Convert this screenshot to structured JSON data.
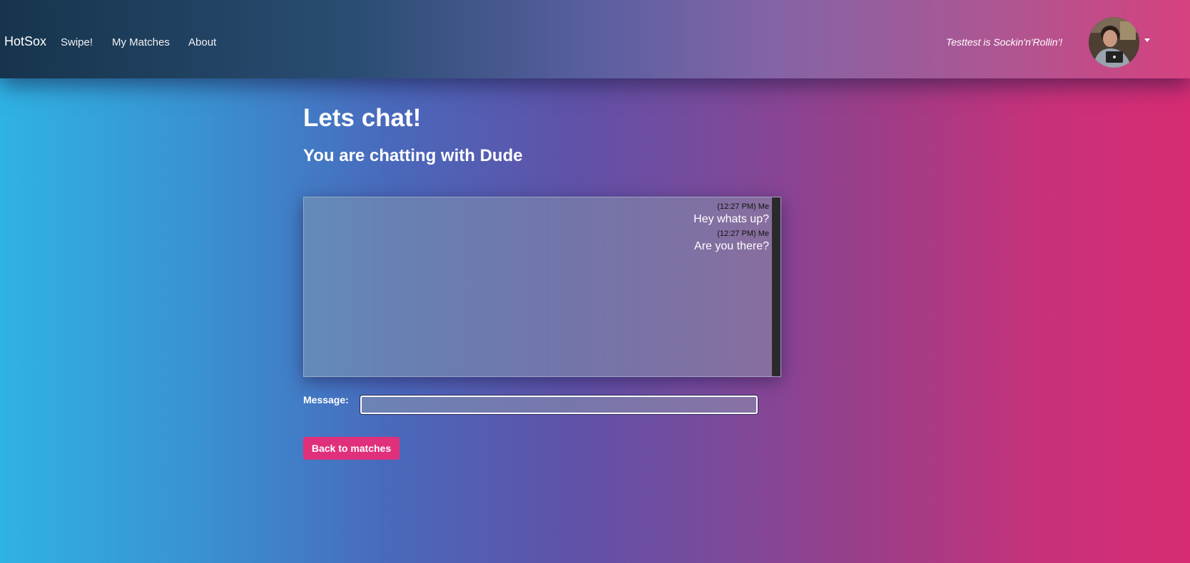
{
  "nav": {
    "brand": "HotSox",
    "links": [
      "Swipe!",
      "My Matches",
      "About"
    ],
    "greeting": "Testtest is Sockin'n'Rollin'!"
  },
  "page": {
    "title": "Lets chat!",
    "subtitle": "You are chatting with Dude"
  },
  "chat": {
    "messages": [
      {
        "meta": "(12:27 PM) Me",
        "text": "Hey whats up?"
      },
      {
        "meta": "(12:27 PM) Me",
        "text": "Are you there?"
      }
    ]
  },
  "form": {
    "message_label": "Message:",
    "message_value": "",
    "back_button": "Back to matches"
  },
  "colors": {
    "accent": "#e0307c",
    "background_left": "#2fb2e4",
    "background_right": "#d72c73"
  }
}
